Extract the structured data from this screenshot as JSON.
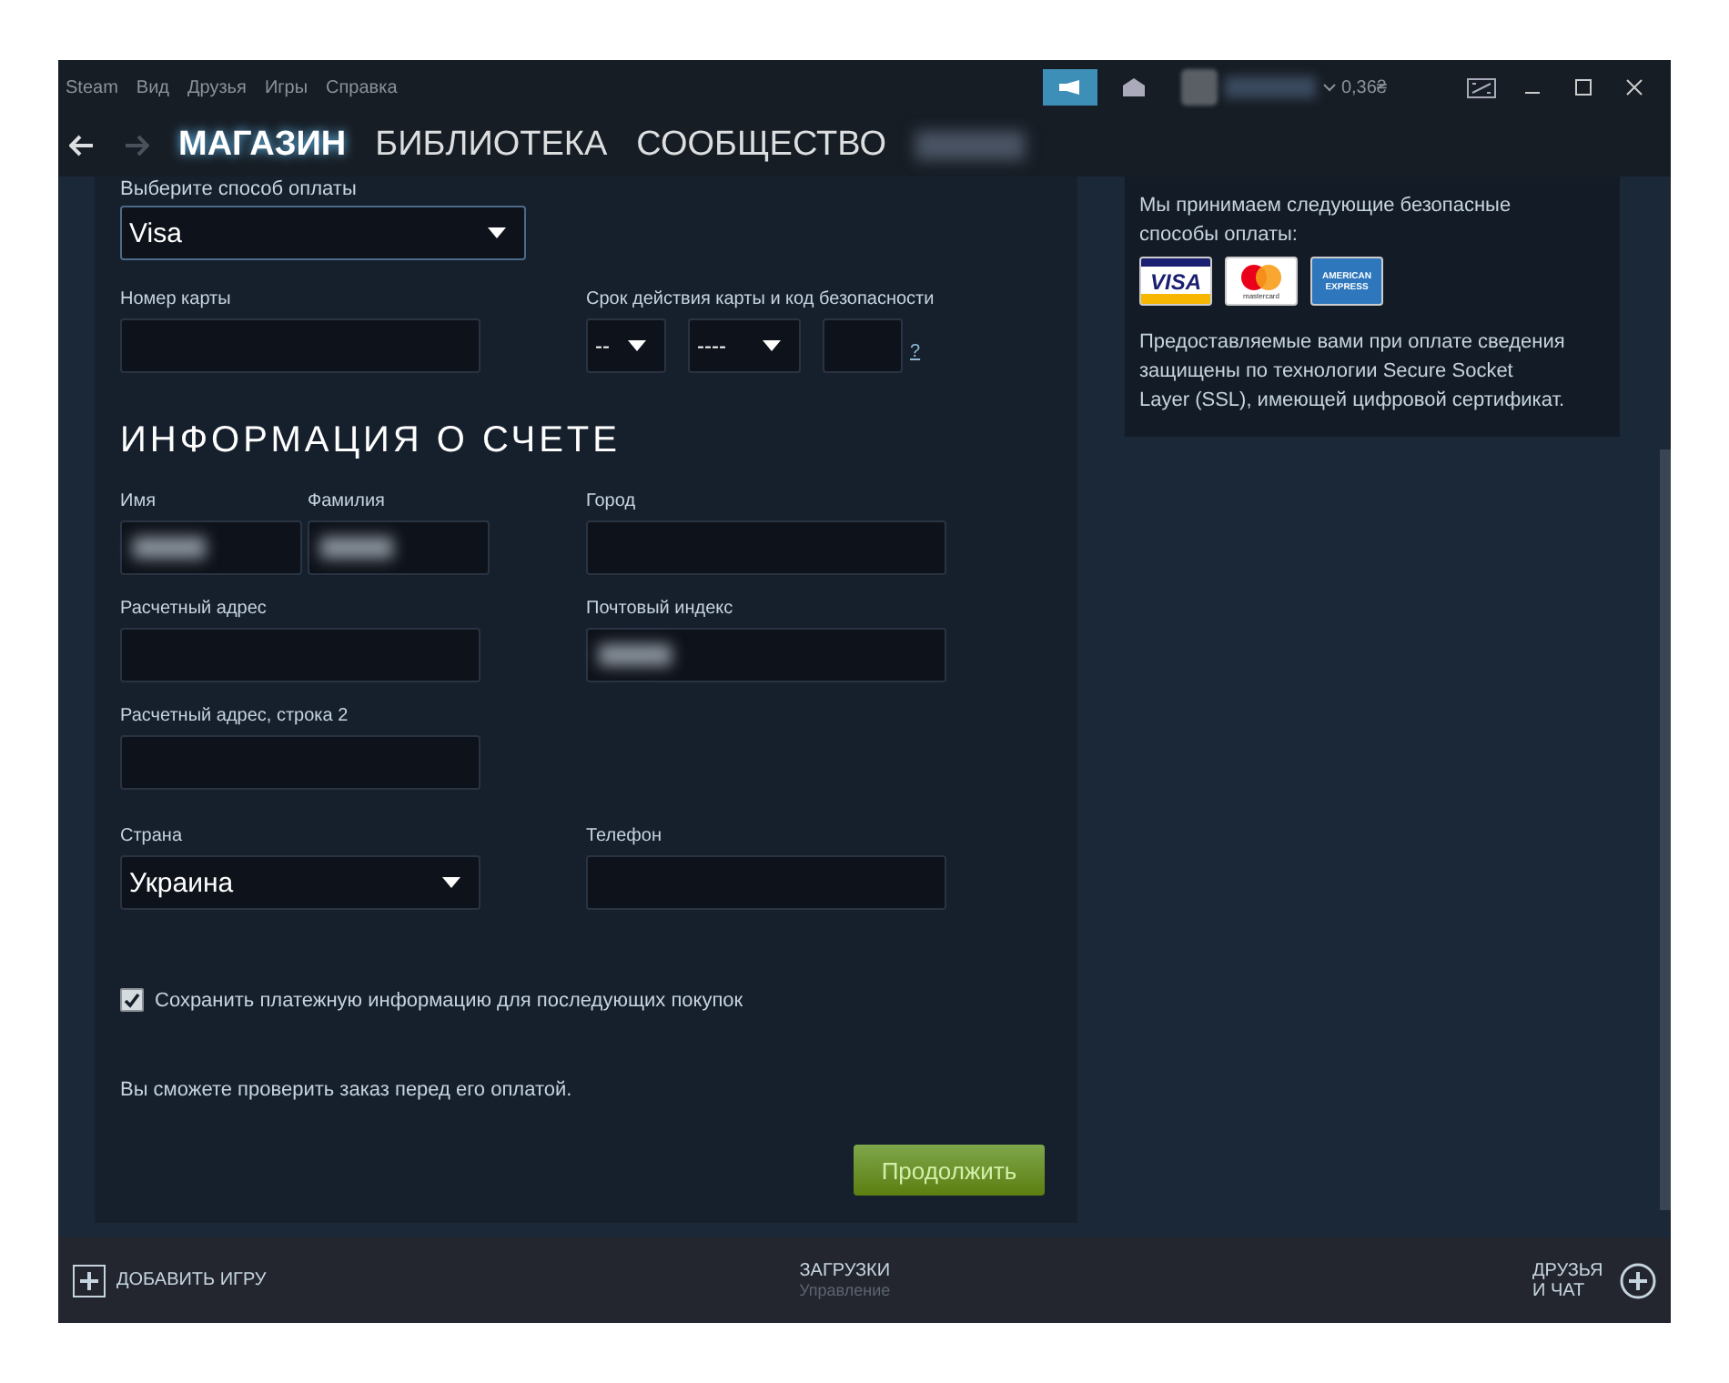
{
  "menu": [
    "Steam",
    "Вид",
    "Друзья",
    "Игры",
    "Справка"
  ],
  "balance": "0,36₴",
  "nav": [
    {
      "label": "МАГАЗИН",
      "selected": true
    },
    {
      "label": "БИБЛИОТЕКА",
      "selected": false
    },
    {
      "label": "СООБЩЕСТВО",
      "selected": false
    }
  ],
  "payment": {
    "label": "Выберите способ оплаты",
    "value": "Visa"
  },
  "card_number": {
    "label": "Номер карты"
  },
  "expiry": {
    "label": "Срок действия карты и код безопасности",
    "month": "--",
    "year": "----",
    "help": "?"
  },
  "section_title": "ИНФОРМАЦИЯ О СЧЕТЕ",
  "rows": [
    {
      "left": [
        {
          "label": "Имя",
          "kind": "blurred"
        },
        {
          "label": "Фамилия",
          "kind": "blurred"
        }
      ],
      "right": [
        {
          "label": "Город",
          "kind": "empty"
        }
      ]
    },
    {
      "left": [
        {
          "label": "Расчетный адрес",
          "kind": "empty"
        }
      ],
      "right": [
        {
          "label": "Почтовый индекс",
          "kind": "blurred"
        }
      ]
    },
    {
      "left": [
        {
          "label": "Расчетный адрес, строка 2",
          "kind": "empty"
        }
      ],
      "right": []
    },
    {
      "left": [
        {
          "label": "Страна",
          "kind": "select",
          "value": "Украина"
        }
      ],
      "right": [
        {
          "label": "Телефон",
          "kind": "empty"
        }
      ]
    }
  ],
  "save": {
    "label": "Сохранить платежную информацию для последующих покупок",
    "checked": true
  },
  "note": "Вы сможете проверить заказ перед его оплатой.",
  "continue_button": "Продолжить",
  "sidebar": {
    "accepted": "Мы принимаем следующие безопасные способы оплаты:",
    "cards": [
      {
        "kind": "visa",
        "text": "VISA"
      },
      {
        "kind": "mastercard",
        "text": "mastercard"
      },
      {
        "kind": "amex",
        "text": "AMERICAN EXPRESS"
      }
    ],
    "ssl": "Предоставляемые вами при оплате сведения защищены по технологии Secure Socket Layer (SSL), имеющей цифровой сертификат."
  },
  "footer": {
    "add_game": "ДОБАВИТЬ ИГРУ",
    "downloads": "ЗАГРУЗКИ",
    "downloads_sub": "Управление",
    "friends": "ДРУЗЬЯ И ЧАТ"
  }
}
